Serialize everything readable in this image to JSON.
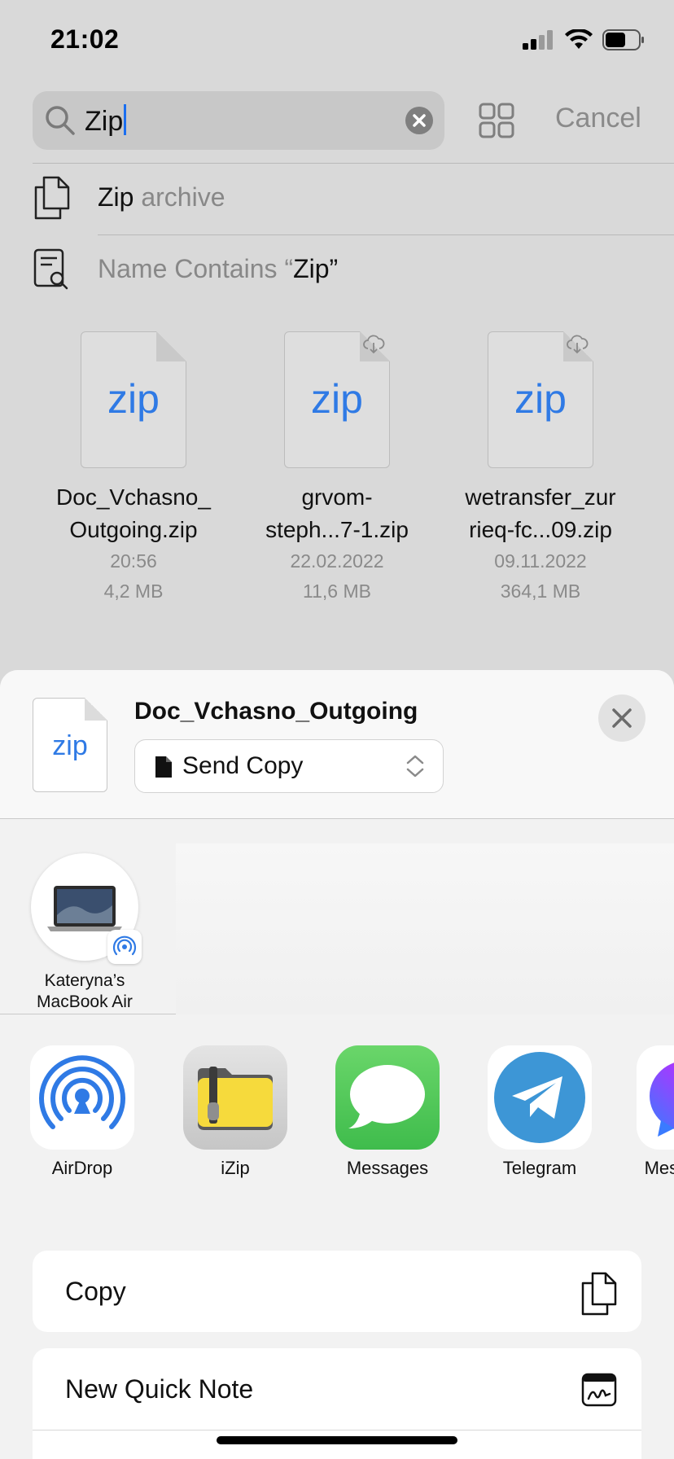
{
  "status_bar": {
    "time": "21:02"
  },
  "search": {
    "query": "Zip",
    "cancel_label": "Cancel"
  },
  "suggestions": [
    {
      "strong": "Zip",
      "rest": " archive"
    },
    {
      "prefix": "Name Contains “",
      "strong": "Zip",
      "suffix": "”"
    }
  ],
  "files": [
    {
      "icon_label": "zip",
      "name_line1": "Doc_Vchasno_",
      "name_line2": "Outgoing.zip",
      "date": "20:56",
      "size": "4,2 MB"
    },
    {
      "icon_label": "zip",
      "name_line1": "grvom-",
      "name_line2": "steph...7-1.zip",
      "date": "22.02.2022",
      "size": "11,6 MB"
    },
    {
      "icon_label": "zip",
      "name_line1": "wetransfer_zur",
      "name_line2": "rieq-fc...09.zip",
      "date": "09.11.2022",
      "size": "364,1 MB"
    }
  ],
  "share_sheet": {
    "thumb_label": "zip",
    "title": "Doc_Vchasno_Outgoing",
    "mode_label": "Send Copy",
    "people": [
      {
        "name_line1": "Kateryna’s",
        "name_line2": "MacBook Air"
      }
    ],
    "apps": [
      {
        "name": "AirDrop"
      },
      {
        "name": "iZip"
      },
      {
        "name": "Messages"
      },
      {
        "name": "Telegram"
      },
      {
        "name": "Messenger"
      }
    ],
    "actions": [
      {
        "label": "Copy"
      },
      {
        "label": "New Quick Note"
      }
    ]
  },
  "colors": {
    "accent_blue": "#2f7ae5",
    "messages_green": "#4fc95b",
    "telegram_blue": "#3d96d6"
  }
}
